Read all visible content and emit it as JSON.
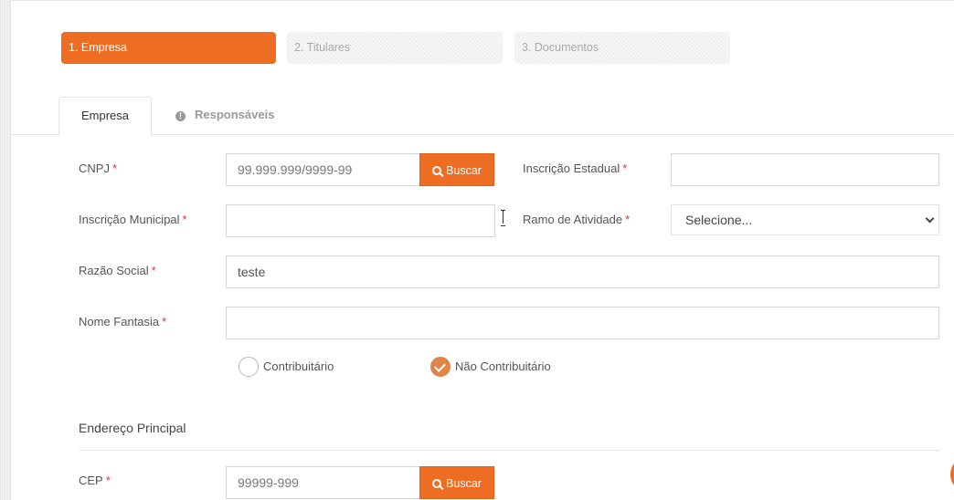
{
  "steps": [
    {
      "label": "1. Empresa",
      "active": true
    },
    {
      "label": "2. Titulares",
      "active": false
    },
    {
      "label": "3. Documentos",
      "active": false
    }
  ],
  "tabs": {
    "empresa": "Empresa",
    "responsaveis": "Responsáveis",
    "info_icon_glyph": "!"
  },
  "form": {
    "cnpj": {
      "label": "CNPJ",
      "required_mark": "*",
      "placeholder": "99.999.999/9999-99"
    },
    "buscar_label": "Buscar",
    "inscricao_estadual": {
      "label": "Inscrição Estadual",
      "required_mark": "*",
      "value": ""
    },
    "inscricao_municipal": {
      "label": "Inscrição Municipal",
      "required_mark": "*",
      "value": ""
    },
    "ramo_atividade": {
      "label": "Ramo de Atividade",
      "required_mark": "*",
      "selected": "Selecione..."
    },
    "razao_social": {
      "label": "Razão Social",
      "required_mark": "*",
      "value": "teste"
    },
    "nome_fantasia": {
      "label": "Nome Fantasia",
      "required_mark": "*",
      "value": ""
    },
    "contribuinte": {
      "options": [
        {
          "label": "Contribuitário",
          "checked": false
        },
        {
          "label": "Não Contribuitário",
          "checked": true
        }
      ]
    }
  },
  "endereco": {
    "title": "Endereço Principal",
    "cep": {
      "label": "CEP",
      "required_mark": "*",
      "placeholder": "99999-999"
    },
    "buscar_label": "Buscar"
  },
  "colors": {
    "accent": "#ef6d22",
    "required": "#e0322f",
    "checked_radio": "#e0854a"
  }
}
